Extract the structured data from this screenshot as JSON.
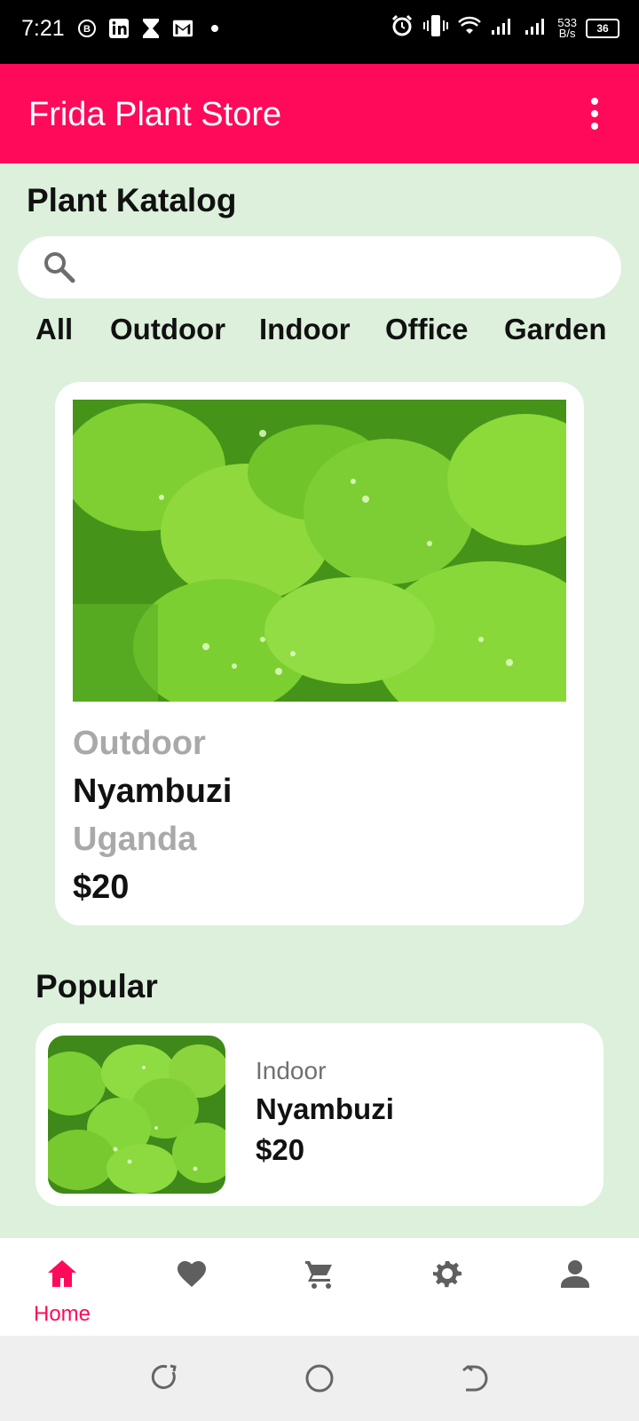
{
  "status_bar": {
    "time": "7:21",
    "net_speed_top": "533",
    "net_speed_bottom": "B/s",
    "battery": "36",
    "icons": [
      "b-circle-icon",
      "linkedin-icon",
      "hourglass-icon",
      "gmail-icon",
      "dot-icon",
      "alarm-icon",
      "vibrate-icon",
      "wifi-icon",
      "signal-icon",
      "signal-icon",
      "battery-icon"
    ]
  },
  "app_bar": {
    "title": "Frida Plant Store",
    "background": "#ff0a5a"
  },
  "page": {
    "title": "Plant Katalog"
  },
  "search": {
    "placeholder": "",
    "value": ""
  },
  "categories": [
    "All",
    "Outdoor",
    "Indoor",
    "Office",
    "Garden"
  ],
  "featured": {
    "category": "Outdoor",
    "name": "Nyambuzi",
    "origin": "Uganda",
    "price": "$20"
  },
  "popular": {
    "title": "Popular",
    "items": [
      {
        "category": "Indoor",
        "name": "Nyambuzi",
        "price": "$20"
      }
    ]
  },
  "bottom_nav": {
    "items": [
      {
        "label": "Home",
        "icon": "home-icon",
        "active": true
      },
      {
        "label": "",
        "icon": "heart-icon",
        "active": false
      },
      {
        "label": "",
        "icon": "cart-icon",
        "active": false
      },
      {
        "label": "",
        "icon": "settings-icon",
        "active": false
      },
      {
        "label": "",
        "icon": "person-icon",
        "active": false
      }
    ],
    "active_color": "#ff0a5a",
    "inactive_color": "#5f5f5f"
  },
  "colors": {
    "accent": "#ff0a5a",
    "background": "#dcf0dc",
    "muted_text": "#a9a9a9"
  }
}
